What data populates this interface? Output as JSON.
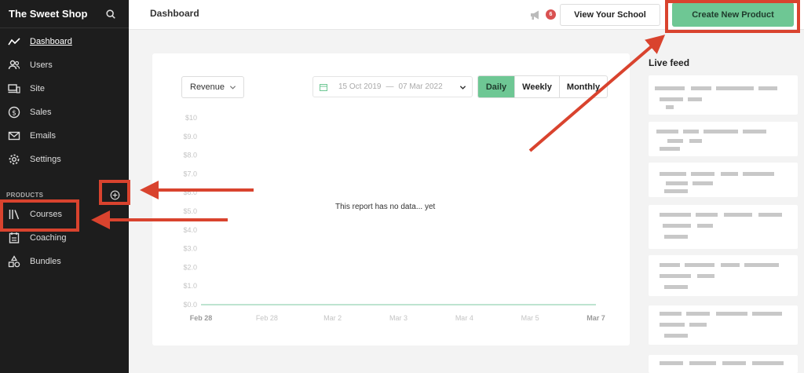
{
  "sidebar": {
    "brand": "The Sweet Shop",
    "items": [
      {
        "label": "Dashboard",
        "icon": "activity-icon"
      },
      {
        "label": "Users",
        "icon": "users-icon"
      },
      {
        "label": "Site",
        "icon": "devices-icon"
      },
      {
        "label": "Sales",
        "icon": "dollar-icon"
      },
      {
        "label": "Emails",
        "icon": "mail-icon"
      },
      {
        "label": "Settings",
        "icon": "gear-icon"
      }
    ],
    "products_heading": "PRODUCTS",
    "products": [
      {
        "label": "Courses",
        "icon": "library-icon"
      },
      {
        "label": "Coaching",
        "icon": "clipboard-icon"
      },
      {
        "label": "Bundles",
        "icon": "shapes-icon"
      }
    ]
  },
  "topbar": {
    "title": "Dashboard",
    "notification_count": "6",
    "view_school_label": "View Your School",
    "create_product_label": "Create New Product"
  },
  "report": {
    "metric": "Revenue",
    "date_from": "15 Oct 2019",
    "date_to": "07 Mar 2022",
    "date_separator": "—",
    "periods": [
      "Daily",
      "Weekly",
      "Monthly"
    ],
    "selected_period": "Daily",
    "empty_message": "This report has no data... yet"
  },
  "chart_data": {
    "type": "line",
    "y_ticks": [
      "$10",
      "$9.0",
      "$8.0",
      "$7.0",
      "$6.0",
      "$5.0",
      "$4.0",
      "$3.0",
      "$2.0",
      "$1.0",
      "$0.0"
    ],
    "x_ticks": [
      "Feb 28",
      "Feb 28",
      "Mar 2",
      "Mar 3",
      "Mar 4",
      "Mar 5",
      "Mar 7"
    ],
    "ylim": [
      0,
      10
    ],
    "series": [
      {
        "values": [
          0,
          0,
          0,
          0,
          0,
          0,
          0
        ]
      }
    ]
  },
  "live_feed": {
    "title": "Live feed"
  },
  "colors": {
    "accent_green": "#6ec794",
    "annotation_red": "#d9432e",
    "sidebar_bg": "#1d1d1d",
    "badge_red": "#d95151"
  }
}
